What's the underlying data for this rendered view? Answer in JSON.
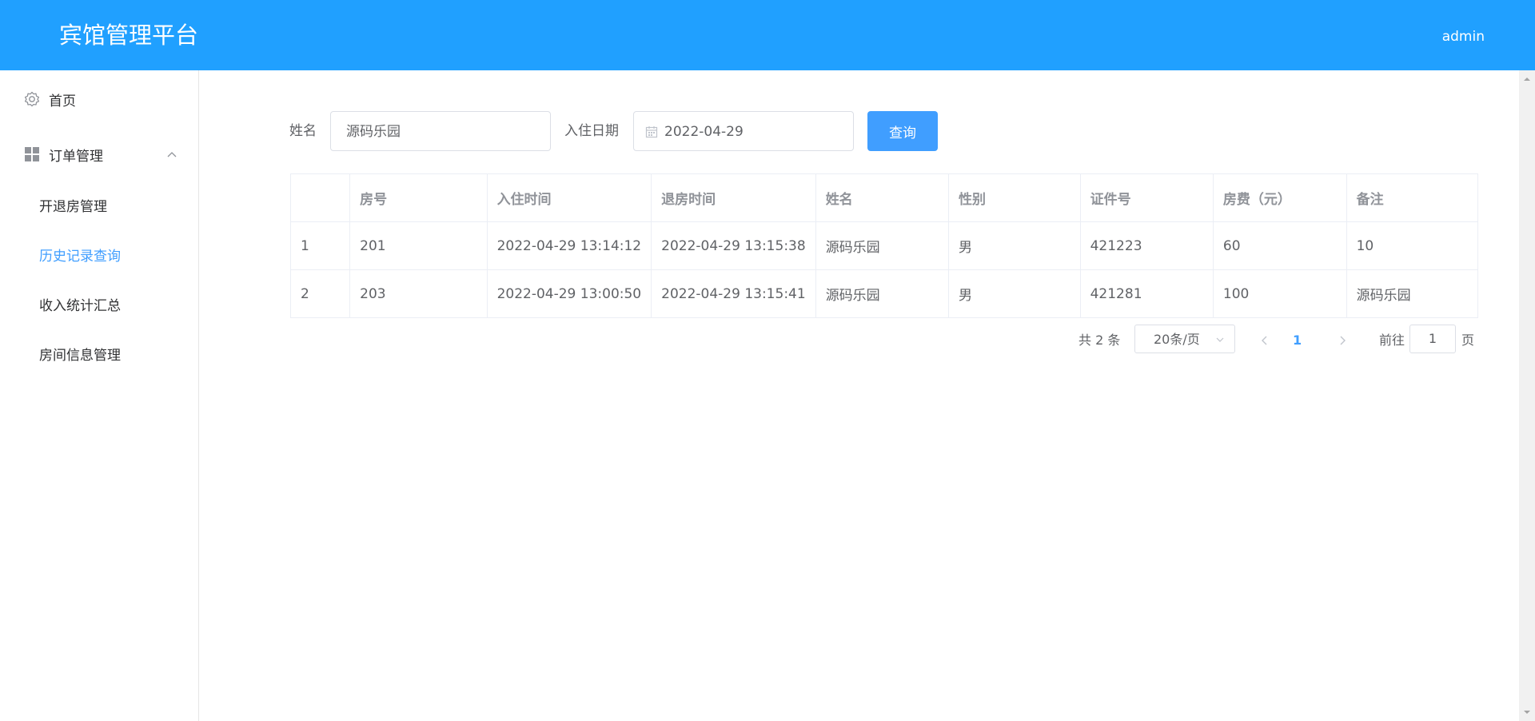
{
  "header": {
    "title": "宾馆管理平台",
    "user": "admin"
  },
  "sidebar": {
    "home": "首页",
    "orders": "订单管理",
    "items": [
      {
        "label": "开退房管理"
      },
      {
        "label": "历史记录查询"
      },
      {
        "label": "收入统计汇总"
      },
      {
        "label": "房间信息管理"
      }
    ]
  },
  "search": {
    "name_label": "姓名",
    "name_value": "源码乐园",
    "date_label": "入住日期",
    "date_value": "2022-04-29",
    "query_label": "查询"
  },
  "table": {
    "headers": [
      "",
      "房号",
      "入住时间",
      "退房时间",
      "姓名",
      "性别",
      "证件号",
      "房费（元）",
      "备注"
    ],
    "rows": [
      [
        "1",
        "201",
        "2022-04-29 13:14:12",
        "2022-04-29 13:15:38",
        "源码乐园",
        "男",
        "421223",
        "60",
        "10"
      ],
      [
        "2",
        "203",
        "2022-04-29 13:00:50",
        "2022-04-29 13:15:41",
        "源码乐园",
        "男",
        "421281",
        "100",
        "源码乐园"
      ]
    ]
  },
  "pager": {
    "total": "共 2 条",
    "size": "20条/页",
    "current": "1",
    "goto_label": "前往",
    "goto_value": "1",
    "page_label": "页"
  }
}
